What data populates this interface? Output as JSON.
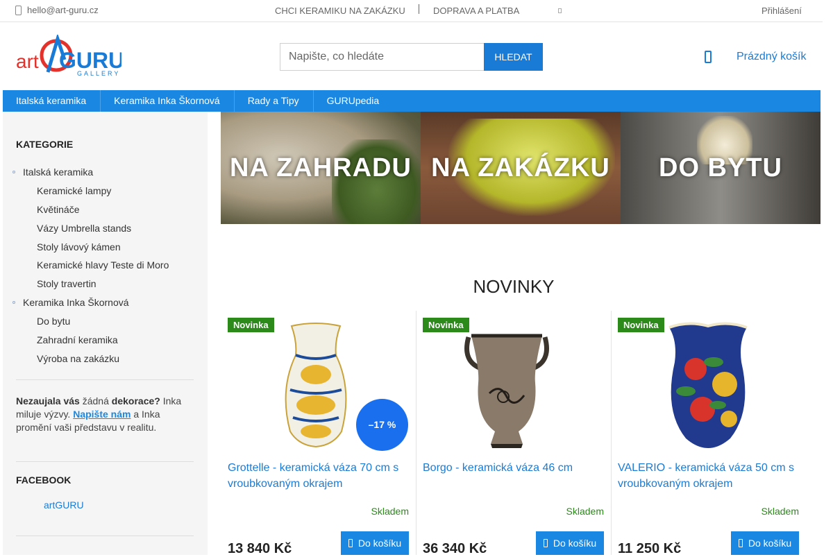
{
  "topbar": {
    "email": "hello@art-guru.cz",
    "link_custom": "CHCI KERAMIKU NA ZAKÁZKU",
    "link_shipping": "DOPRAVA A PLATBA",
    "login": "Přihlášení"
  },
  "logo": {
    "word_left": "art",
    "word_right": "GURU",
    "tagline": "GALLERY"
  },
  "search": {
    "placeholder": "Napište, co hledáte",
    "button": "HLEDAT"
  },
  "cart": {
    "label": "Prázdný košík"
  },
  "nav": {
    "items": [
      "Italská keramika",
      "Keramika Inka Škornová",
      "Rady a Tipy",
      "GURUpedia"
    ]
  },
  "sidebar": {
    "categories_title": "KATEGORIE",
    "categories": [
      {
        "label": "Italská keramika",
        "level": 1
      },
      {
        "label": "Keramické lampy",
        "level": 2
      },
      {
        "label": "Květináče",
        "level": 2
      },
      {
        "label": "Vázy Umbrella stands",
        "level": 2
      },
      {
        "label": "Stoly lávový kámen",
        "level": 2
      },
      {
        "label": "Keramické hlavy Teste di Moro",
        "level": 2
      },
      {
        "label": "Stoly travertin",
        "level": 2
      },
      {
        "label": "Keramika Inka Škornová",
        "level": 1
      },
      {
        "label": "Do bytu",
        "level": 2
      },
      {
        "label": "Zahradní keramika",
        "level": 2
      },
      {
        "label": "Výroba na zakázku",
        "level": 2
      }
    ],
    "promo": {
      "p1": "Nezaujala vás",
      "p2": " žádná ",
      "p3": "dekorace?",
      "p4": " Inka miluje výzvy. ",
      "link": "Napište nám",
      "p5": " a Inka promění vaši představu v realitu."
    },
    "facebook_title": "FACEBOOK",
    "facebook_link": "artGURU"
  },
  "banners": [
    "NA ZAHRADU",
    "NA ZAKÁZKU",
    "DO BYTU"
  ],
  "section_title": "NOVINKY",
  "products": [
    {
      "badge": "Novinka",
      "name": "Grottelle - keramická váza 70 cm s vroubkovaným okrajem",
      "stock": "Skladem",
      "price": "13 840 Kč",
      "buy": "Do košíku",
      "discount": "–17 %"
    },
    {
      "badge": "Novinka",
      "name": "Borgo - keramická váza 46 cm",
      "stock": "Skladem",
      "price": "36 340 Kč",
      "buy": "Do košíku"
    },
    {
      "badge": "Novinka",
      "name": "VALERIO - keramická váza 50 cm s vroubkovaným okrajem",
      "stock": "Skladem",
      "price": "11 250 Kč",
      "buy": "Do košíku"
    }
  ],
  "colors": {
    "primary": "#1a88e3",
    "badge": "#2b8a1a",
    "discount": "#1a6fee"
  }
}
